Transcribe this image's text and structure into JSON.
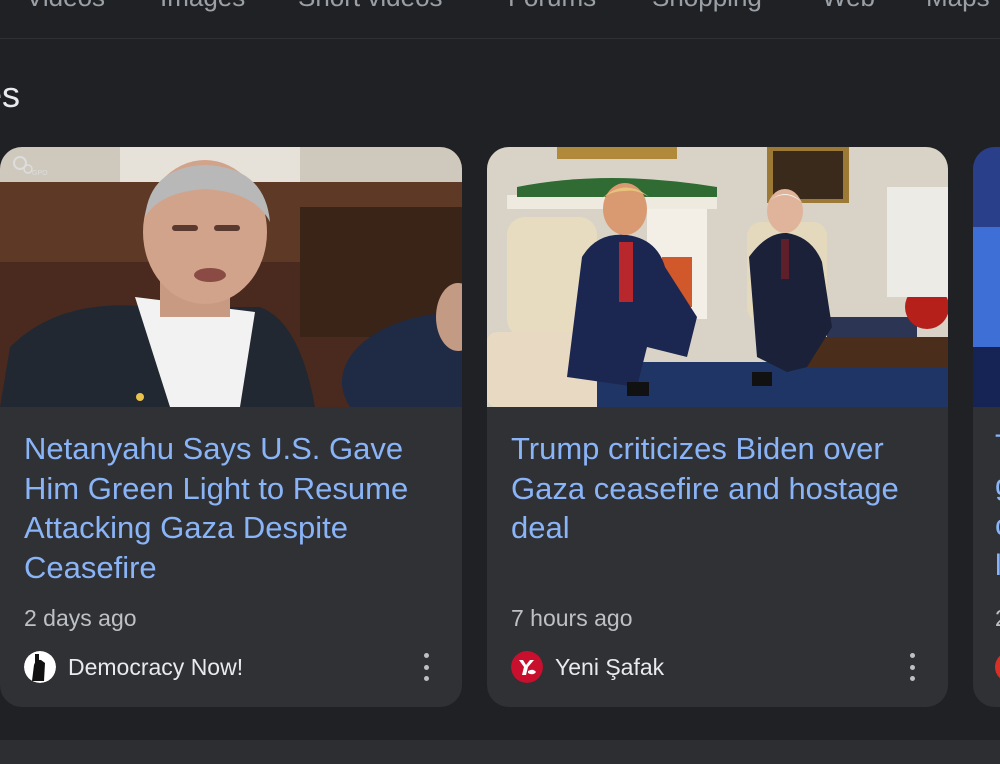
{
  "tabs": [
    "Videos",
    "Images",
    "Short videos",
    "Forums",
    "Shopping",
    "Web",
    "Maps"
  ],
  "section": {
    "title": "es"
  },
  "cards": [
    {
      "headline": "Netanyahu Says U.S. Gave Him Green Light to Resume Attacking Gaza Despite Ceasefire",
      "time": "2 days ago",
      "source": "Democracy Now!",
      "thumbnail_icon": "news-photo-netanyahu",
      "watermark": "GPO"
    },
    {
      "headline": "Trump criticizes Biden over Gaza ceasefire and hostage deal",
      "time": "7 hours ago",
      "source": "Yeni Şafak",
      "thumbnail_icon": "news-photo-oval-office"
    }
  ],
  "colors": {
    "background": "#202124",
    "card": "#303134",
    "headline": "#8ab4f8",
    "meta": "#bdc1c6"
  }
}
